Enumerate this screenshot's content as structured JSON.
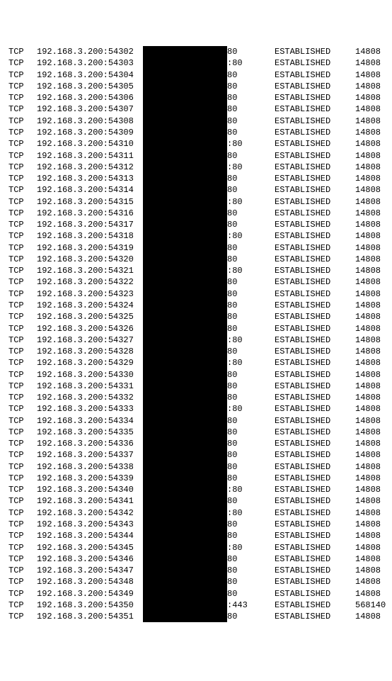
{
  "connections": [
    {
      "proto": "TCP",
      "local": "192.168.3.200:54302",
      "foreign": "80",
      "state": "ESTABLISHED",
      "pid": "14808"
    },
    {
      "proto": "TCP",
      "local": "192.168.3.200:54303",
      "foreign": ":80",
      "state": "ESTABLISHED",
      "pid": "14808"
    },
    {
      "proto": "TCP",
      "local": "192.168.3.200:54304",
      "foreign": "80",
      "state": "ESTABLISHED",
      "pid": "14808"
    },
    {
      "proto": "TCP",
      "local": "192.168.3.200:54305",
      "foreign": "80",
      "state": "ESTABLISHED",
      "pid": "14808"
    },
    {
      "proto": "TCP",
      "local": "192.168.3.200:54306",
      "foreign": "80",
      "state": "ESTABLISHED",
      "pid": "14808"
    },
    {
      "proto": "TCP",
      "local": "192.168.3.200:54307",
      "foreign": "80",
      "state": "ESTABLISHED",
      "pid": "14808"
    },
    {
      "proto": "TCP",
      "local": "192.168.3.200:54308",
      "foreign": "80",
      "state": "ESTABLISHED",
      "pid": "14808"
    },
    {
      "proto": "TCP",
      "local": "192.168.3.200:54309",
      "foreign": "80",
      "state": "ESTABLISHED",
      "pid": "14808"
    },
    {
      "proto": "TCP",
      "local": "192.168.3.200:54310",
      "foreign": ":80",
      "state": "ESTABLISHED",
      "pid": "14808"
    },
    {
      "proto": "TCP",
      "local": "192.168.3.200:54311",
      "foreign": "80",
      "state": "ESTABLISHED",
      "pid": "14808"
    },
    {
      "proto": "TCP",
      "local": "192.168.3.200:54312",
      "foreign": ":80",
      "state": "ESTABLISHED",
      "pid": "14808"
    },
    {
      "proto": "TCP",
      "local": "192.168.3.200:54313",
      "foreign": "80",
      "state": "ESTABLISHED",
      "pid": "14808"
    },
    {
      "proto": "TCP",
      "local": "192.168.3.200:54314",
      "foreign": "80",
      "state": "ESTABLISHED",
      "pid": "14808"
    },
    {
      "proto": "TCP",
      "local": "192.168.3.200:54315",
      "foreign": ":80",
      "state": "ESTABLISHED",
      "pid": "14808"
    },
    {
      "proto": "TCP",
      "local": "192.168.3.200:54316",
      "foreign": "80",
      "state": "ESTABLISHED",
      "pid": "14808"
    },
    {
      "proto": "TCP",
      "local": "192.168.3.200:54317",
      "foreign": "80",
      "state": "ESTABLISHED",
      "pid": "14808"
    },
    {
      "proto": "TCP",
      "local": "192.168.3.200:54318",
      "foreign": ":80",
      "state": "ESTABLISHED",
      "pid": "14808"
    },
    {
      "proto": "TCP",
      "local": "192.168.3.200:54319",
      "foreign": "80",
      "state": "ESTABLISHED",
      "pid": "14808"
    },
    {
      "proto": "TCP",
      "local": "192.168.3.200:54320",
      "foreign": "80",
      "state": "ESTABLISHED",
      "pid": "14808"
    },
    {
      "proto": "TCP",
      "local": "192.168.3.200:54321",
      "foreign": ":80",
      "state": "ESTABLISHED",
      "pid": "14808"
    },
    {
      "proto": "TCP",
      "local": "192.168.3.200:54322",
      "foreign": "80",
      "state": "ESTABLISHED",
      "pid": "14808"
    },
    {
      "proto": "TCP",
      "local": "192.168.3.200:54323",
      "foreign": "80",
      "state": "ESTABLISHED",
      "pid": "14808"
    },
    {
      "proto": "TCP",
      "local": "192.168.3.200:54324",
      "foreign": "80",
      "state": "ESTABLISHED",
      "pid": "14808"
    },
    {
      "proto": "TCP",
      "local": "192.168.3.200:54325",
      "foreign": "80",
      "state": "ESTABLISHED",
      "pid": "14808"
    },
    {
      "proto": "TCP",
      "local": "192.168.3.200:54326",
      "foreign": "80",
      "state": "ESTABLISHED",
      "pid": "14808"
    },
    {
      "proto": "TCP",
      "local": "192.168.3.200:54327",
      "foreign": ":80",
      "state": "ESTABLISHED",
      "pid": "14808"
    },
    {
      "proto": "TCP",
      "local": "192.168.3.200:54328",
      "foreign": "80",
      "state": "ESTABLISHED",
      "pid": "14808"
    },
    {
      "proto": "TCP",
      "local": "192.168.3.200:54329",
      "foreign": ":80",
      "state": "ESTABLISHED",
      "pid": "14808"
    },
    {
      "proto": "TCP",
      "local": "192.168.3.200:54330",
      "foreign": "80",
      "state": "ESTABLISHED",
      "pid": "14808"
    },
    {
      "proto": "TCP",
      "local": "192.168.3.200:54331",
      "foreign": "80",
      "state": "ESTABLISHED",
      "pid": "14808"
    },
    {
      "proto": "TCP",
      "local": "192.168.3.200:54332",
      "foreign": "80",
      "state": "ESTABLISHED",
      "pid": "14808"
    },
    {
      "proto": "TCP",
      "local": "192.168.3.200:54333",
      "foreign": ":80",
      "state": "ESTABLISHED",
      "pid": "14808"
    },
    {
      "proto": "TCP",
      "local": "192.168.3.200:54334",
      "foreign": "80",
      "state": "ESTABLISHED",
      "pid": "14808"
    },
    {
      "proto": "TCP",
      "local": "192.168.3.200:54335",
      "foreign": "80",
      "state": "ESTABLISHED",
      "pid": "14808"
    },
    {
      "proto": "TCP",
      "local": "192.168.3.200:54336",
      "foreign": "80",
      "state": "ESTABLISHED",
      "pid": "14808"
    },
    {
      "proto": "TCP",
      "local": "192.168.3.200:54337",
      "foreign": "80",
      "state": "ESTABLISHED",
      "pid": "14808"
    },
    {
      "proto": "TCP",
      "local": "192.168.3.200:54338",
      "foreign": "80",
      "state": "ESTABLISHED",
      "pid": "14808"
    },
    {
      "proto": "TCP",
      "local": "192.168.3.200:54339",
      "foreign": "80",
      "state": "ESTABLISHED",
      "pid": "14808"
    },
    {
      "proto": "TCP",
      "local": "192.168.3.200:54340",
      "foreign": ":80",
      "state": "ESTABLISHED",
      "pid": "14808"
    },
    {
      "proto": "TCP",
      "local": "192.168.3.200:54341",
      "foreign": "80",
      "state": "ESTABLISHED",
      "pid": "14808"
    },
    {
      "proto": "TCP",
      "local": "192.168.3.200:54342",
      "foreign": ":80",
      "state": "ESTABLISHED",
      "pid": "14808"
    },
    {
      "proto": "TCP",
      "local": "192.168.3.200:54343",
      "foreign": "80",
      "state": "ESTABLISHED",
      "pid": "14808"
    },
    {
      "proto": "TCP",
      "local": "192.168.3.200:54344",
      "foreign": "80",
      "state": "ESTABLISHED",
      "pid": "14808"
    },
    {
      "proto": "TCP",
      "local": "192.168.3.200:54345",
      "foreign": ":80",
      "state": "ESTABLISHED",
      "pid": "14808"
    },
    {
      "proto": "TCP",
      "local": "192.168.3.200:54346",
      "foreign": "80",
      "state": "ESTABLISHED",
      "pid": "14808"
    },
    {
      "proto": "TCP",
      "local": "192.168.3.200:54347",
      "foreign": "80",
      "state": "ESTABLISHED",
      "pid": "14808"
    },
    {
      "proto": "TCP",
      "local": "192.168.3.200:54348",
      "foreign": "80",
      "state": "ESTABLISHED",
      "pid": "14808"
    },
    {
      "proto": "TCP",
      "local": "192.168.3.200:54349",
      "foreign": "80",
      "state": "ESTABLISHED",
      "pid": "14808"
    },
    {
      "proto": "TCP",
      "local": "192.168.3.200:54350",
      "foreign": ":443",
      "state": "ESTABLISHED",
      "pid": "568140"
    },
    {
      "proto": "TCP",
      "local": "192.168.3.200:54351",
      "foreign": "80",
      "state": "ESTABLISHED",
      "pid": "14808"
    }
  ]
}
